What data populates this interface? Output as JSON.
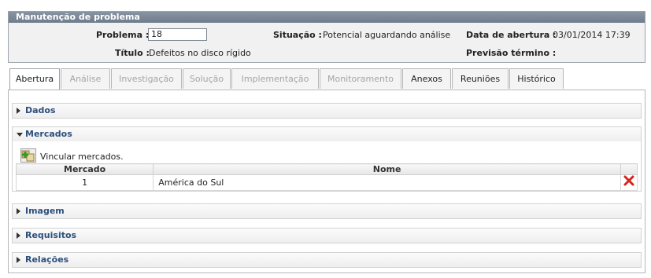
{
  "panel": {
    "title": "Manutenção de problema",
    "problema_label": "Problema :",
    "problema_value": "18",
    "titulo_label": "Título :",
    "titulo_value": "Defeitos no disco rígido",
    "situacao_label": "Situação :",
    "situacao_value": "Potencial aguardando análise",
    "data_abertura_label": "Data de abertura :",
    "data_abertura_value": "03/01/2014 17:39",
    "previsao_label": "Previsão término :",
    "previsao_value": ""
  },
  "tabs": [
    {
      "label": "Abertura",
      "state": "active"
    },
    {
      "label": "Análise",
      "state": "disabled"
    },
    {
      "label": "Investigação",
      "state": "disabled"
    },
    {
      "label": "Solução",
      "state": "disabled"
    },
    {
      "label": "Implementação",
      "state": "disabled"
    },
    {
      "label": "Monitoramento",
      "state": "disabled"
    },
    {
      "label": "Anexos",
      "state": "enabled"
    },
    {
      "label": "Reuniões",
      "state": "enabled"
    },
    {
      "label": "Histórico",
      "state": "enabled"
    }
  ],
  "sections": {
    "dados": "Dados",
    "mercados": "Mercados",
    "imagem": "Imagem",
    "requisitos": "Requisitos",
    "relacoes": "Relações"
  },
  "mercados": {
    "add_label": "Vincular mercados.",
    "columns": [
      "Mercado",
      "Nome"
    ],
    "rows": [
      {
        "mercado": "1",
        "nome": "América do Sul"
      }
    ]
  },
  "icons": {
    "add": "add-market-icon",
    "delete": "delete-icon"
  },
  "colors": {
    "header_bar": "#7a8696",
    "section_title": "#2d4f7c",
    "delete_red": "#d9221c"
  }
}
